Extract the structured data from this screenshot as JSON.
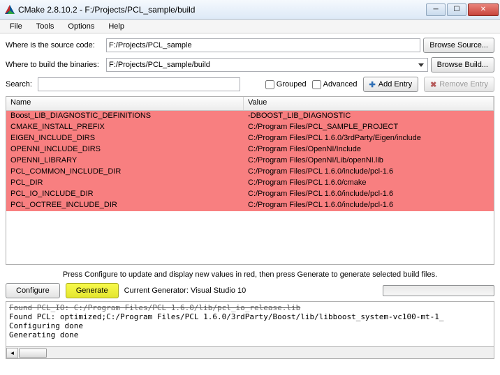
{
  "window": {
    "title": "CMake 2.8.10.2 - F:/Projects/PCL_sample/build"
  },
  "menu": {
    "file": "File",
    "tools": "Tools",
    "options": "Options",
    "help": "Help"
  },
  "labels": {
    "source": "Where is the source code:",
    "build": "Where to build the binaries:",
    "search": "Search:",
    "grouped": "Grouped",
    "advanced": "Advanced",
    "browse_source": "Browse Source...",
    "browse_build": "Browse Build...",
    "add_entry": "Add Entry",
    "remove_entry": "Remove Entry",
    "configure": "Configure",
    "generate": "Generate",
    "current_generator": "Current Generator: Visual Studio 10",
    "help_text": "Press Configure to update and display new values in red, then press Generate to generate selected build files."
  },
  "paths": {
    "source": "F:/Projects/PCL_sample",
    "build": "F:/Projects/PCL_sample/build"
  },
  "grid": {
    "col_name": "Name",
    "col_value": "Value",
    "rows": [
      {
        "name": "Boost_LIB_DIAGNOSTIC_DEFINITIONS",
        "value": "-DBOOST_LIB_DIAGNOSTIC"
      },
      {
        "name": "CMAKE_INSTALL_PREFIX",
        "value": "C:/Program Files/PCL_SAMPLE_PROJECT"
      },
      {
        "name": "EIGEN_INCLUDE_DIRS",
        "value": "C:/Program Files/PCL 1.6.0/3rdParty/Eigen/include"
      },
      {
        "name": "OPENNI_INCLUDE_DIRS",
        "value": "C:/Program Files/OpenNI/Include"
      },
      {
        "name": "OPENNI_LIBRARY",
        "value": "C:/Program Files/OpenNI/Lib/openNI.lib"
      },
      {
        "name": "PCL_COMMON_INCLUDE_DIR",
        "value": "C:/Program Files/PCL 1.6.0/include/pcl-1.6"
      },
      {
        "name": "PCL_DIR",
        "value": "C:/Program Files/PCL 1.6.0/cmake"
      },
      {
        "name": "PCL_IO_INCLUDE_DIR",
        "value": "C:/Program Files/PCL 1.6.0/include/pcl-1.6"
      },
      {
        "name": "PCL_OCTREE_INCLUDE_DIR",
        "value": "C:/Program Files/PCL 1.6.0/include/pcl-1.6"
      }
    ]
  },
  "log": {
    "line0": "Found PCL_IO: C:/Program Files/PCL 1.6.0/lib/pcl_io_release.lib",
    "line1": "Found PCL: optimized;C:/Program Files/PCL 1.6.0/3rdParty/Boost/lib/libboost_system-vc100-mt-1_",
    "line2": "Configuring done",
    "line3": "Generating done"
  }
}
